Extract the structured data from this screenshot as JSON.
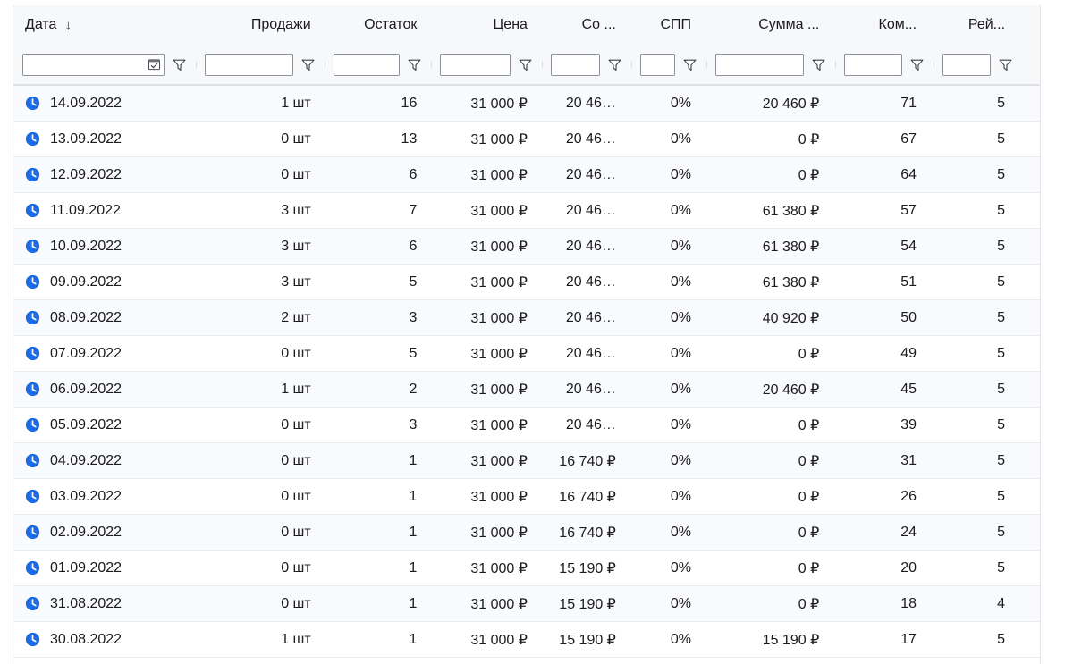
{
  "table": {
    "columns": [
      {
        "key": "date",
        "label": "Дата",
        "align": "left",
        "sorted": true,
        "sort_arrow": "↓",
        "filter_type": "date",
        "filter_value": ""
      },
      {
        "key": "sales",
        "label": "Продажи",
        "align": "right",
        "sorted": false,
        "sort_arrow": "",
        "filter_type": "text",
        "filter_value": ""
      },
      {
        "key": "stock",
        "label": "Остаток",
        "align": "right",
        "sorted": false,
        "sort_arrow": "",
        "filter_type": "text",
        "filter_value": ""
      },
      {
        "key": "price",
        "label": "Цена",
        "align": "right",
        "sorted": false,
        "sort_arrow": "",
        "filter_type": "text",
        "filter_value": ""
      },
      {
        "key": "sopp",
        "label": "Со ...",
        "align": "right",
        "sorted": false,
        "sort_arrow": "",
        "filter_type": "text",
        "filter_value": ""
      },
      {
        "key": "spp",
        "label": "СПП",
        "align": "right",
        "sorted": false,
        "sort_arrow": "",
        "filter_type": "text",
        "filter_value": ""
      },
      {
        "key": "sum",
        "label": "Сумма ...",
        "align": "right",
        "sorted": false,
        "sort_arrow": "",
        "filter_type": "text",
        "filter_value": ""
      },
      {
        "key": "com",
        "label": "Ком...",
        "align": "right",
        "sorted": false,
        "sort_arrow": "",
        "filter_type": "text",
        "filter_value": ""
      },
      {
        "key": "rate",
        "label": "Рей...",
        "align": "right",
        "sorted": false,
        "sort_arrow": "",
        "filter_type": "text",
        "filter_value": ""
      }
    ],
    "filter_icon": "funnel-icon",
    "date_filter_icon": "calendar-icon",
    "row_icon": "clock-icon",
    "rows": [
      {
        "date": "14.09.2022",
        "sales": "1 шт",
        "stock": "16",
        "price": "31 000 ₽",
        "sopp": "20 46…",
        "spp": "0%",
        "sum": "20 460 ₽",
        "com": "71",
        "rate": "5"
      },
      {
        "date": "13.09.2022",
        "sales": "0 шт",
        "stock": "13",
        "price": "31 000 ₽",
        "sopp": "20 46…",
        "spp": "0%",
        "sum": "0 ₽",
        "com": "67",
        "rate": "5"
      },
      {
        "date": "12.09.2022",
        "sales": "0 шт",
        "stock": "6",
        "price": "31 000 ₽",
        "sopp": "20 46…",
        "spp": "0%",
        "sum": "0 ₽",
        "com": "64",
        "rate": "5"
      },
      {
        "date": "11.09.2022",
        "sales": "3 шт",
        "stock": "7",
        "price": "31 000 ₽",
        "sopp": "20 46…",
        "spp": "0%",
        "sum": "61 380 ₽",
        "com": "57",
        "rate": "5"
      },
      {
        "date": "10.09.2022",
        "sales": "3 шт",
        "stock": "6",
        "price": "31 000 ₽",
        "sopp": "20 46…",
        "spp": "0%",
        "sum": "61 380 ₽",
        "com": "54",
        "rate": "5"
      },
      {
        "date": "09.09.2022",
        "sales": "3 шт",
        "stock": "5",
        "price": "31 000 ₽",
        "sopp": "20 46…",
        "spp": "0%",
        "sum": "61 380 ₽",
        "com": "51",
        "rate": "5"
      },
      {
        "date": "08.09.2022",
        "sales": "2 шт",
        "stock": "3",
        "price": "31 000 ₽",
        "sopp": "20 46…",
        "spp": "0%",
        "sum": "40 920 ₽",
        "com": "50",
        "rate": "5"
      },
      {
        "date": "07.09.2022",
        "sales": "0 шт",
        "stock": "5",
        "price": "31 000 ₽",
        "sopp": "20 46…",
        "spp": "0%",
        "sum": "0 ₽",
        "com": "49",
        "rate": "5"
      },
      {
        "date": "06.09.2022",
        "sales": "1 шт",
        "stock": "2",
        "price": "31 000 ₽",
        "sopp": "20 46…",
        "spp": "0%",
        "sum": "20 460 ₽",
        "com": "45",
        "rate": "5"
      },
      {
        "date": "05.09.2022",
        "sales": "0 шт",
        "stock": "3",
        "price": "31 000 ₽",
        "sopp": "20 46…",
        "spp": "0%",
        "sum": "0 ₽",
        "com": "39",
        "rate": "5"
      },
      {
        "date": "04.09.2022",
        "sales": "0 шт",
        "stock": "1",
        "price": "31 000 ₽",
        "sopp": "16 740 ₽",
        "spp": "0%",
        "sum": "0 ₽",
        "com": "31",
        "rate": "5"
      },
      {
        "date": "03.09.2022",
        "sales": "0 шт",
        "stock": "1",
        "price": "31 000 ₽",
        "sopp": "16 740 ₽",
        "spp": "0%",
        "sum": "0 ₽",
        "com": "26",
        "rate": "5"
      },
      {
        "date": "02.09.2022",
        "sales": "0 шт",
        "stock": "1",
        "price": "31 000 ₽",
        "sopp": "16 740 ₽",
        "spp": "0%",
        "sum": "0 ₽",
        "com": "24",
        "rate": "5"
      },
      {
        "date": "01.09.2022",
        "sales": "0 шт",
        "stock": "1",
        "price": "31 000 ₽",
        "sopp": "15 190 ₽",
        "spp": "0%",
        "sum": "0 ₽",
        "com": "20",
        "rate": "5"
      },
      {
        "date": "31.08.2022",
        "sales": "0 шт",
        "stock": "1",
        "price": "31 000 ₽",
        "sopp": "15 190 ₽",
        "spp": "0%",
        "sum": "0 ₽",
        "com": "18",
        "rate": "4"
      },
      {
        "date": "30.08.2022",
        "sales": "1 шт",
        "stock": "1",
        "price": "31 000 ₽",
        "sopp": "15 190 ₽",
        "spp": "0%",
        "sum": "15 190 ₽",
        "com": "17",
        "rate": "5"
      }
    ]
  },
  "colors": {
    "icon_blue": "#1c6ae4",
    "header_bg": "#f7f8fa",
    "row_stripe": "#f9fafd",
    "border": "#e9eaee",
    "text": "#1b1b1f"
  }
}
